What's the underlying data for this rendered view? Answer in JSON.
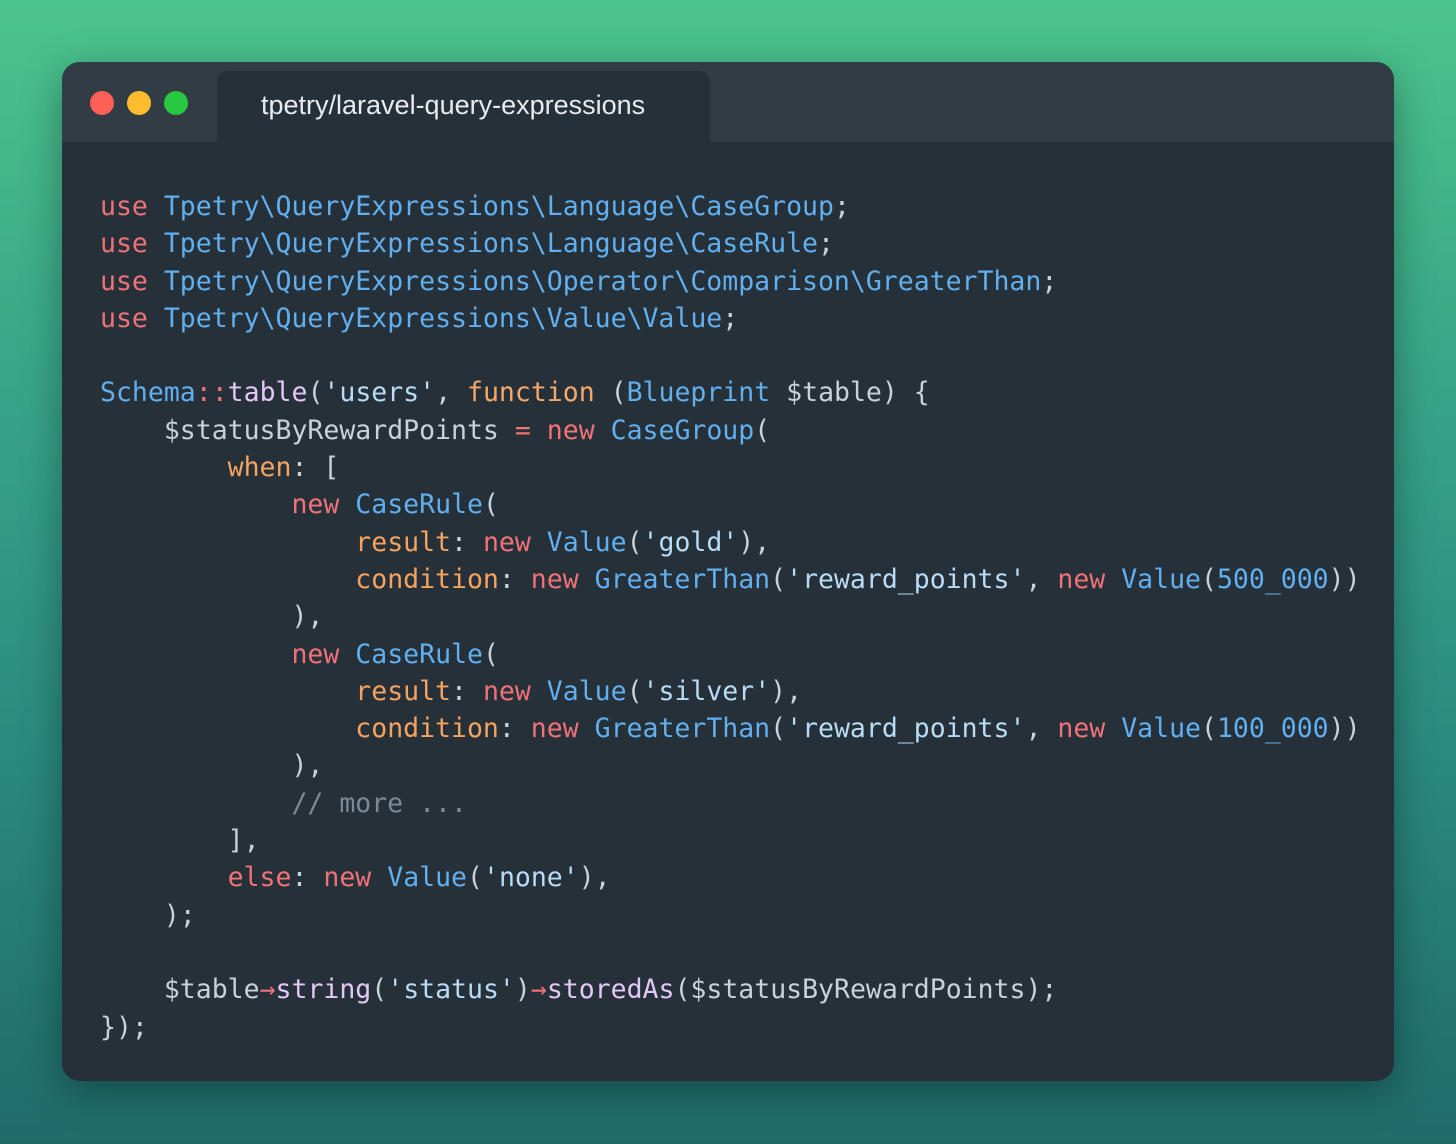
{
  "window": {
    "tab_title": "tpetry/laravel-query-expressions",
    "controls": [
      {
        "name": "close-button",
        "color": "#fe5f57"
      },
      {
        "name": "minimize-button",
        "color": "#febc2e"
      },
      {
        "name": "maximize-button",
        "color": "#28c840"
      }
    ]
  },
  "colors": {
    "keyword": "#f07178",
    "class": "#61afef",
    "string": "#b8dcf6",
    "named_argument": "#f5a35f",
    "method": "#e3c7f6",
    "comment": "#7d8a94",
    "text": "#c9d1d9",
    "background": "#263038"
  },
  "code": {
    "language": "php",
    "lines": [
      [
        [
          "keyword",
          "use"
        ],
        [
          "plain",
          " "
        ],
        [
          "class",
          "Tpetry\\QueryExpressions\\Language\\CaseGroup"
        ],
        [
          "punct",
          ";"
        ]
      ],
      [
        [
          "keyword",
          "use"
        ],
        [
          "plain",
          " "
        ],
        [
          "class",
          "Tpetry\\QueryExpressions\\Language\\CaseRule"
        ],
        [
          "punct",
          ";"
        ]
      ],
      [
        [
          "keyword",
          "use"
        ],
        [
          "plain",
          " "
        ],
        [
          "class",
          "Tpetry\\QueryExpressions\\Operator\\Comparison\\GreaterThan"
        ],
        [
          "punct",
          ";"
        ]
      ],
      [
        [
          "keyword",
          "use"
        ],
        [
          "plain",
          " "
        ],
        [
          "class",
          "Tpetry\\QueryExpressions\\Value\\Value"
        ],
        [
          "punct",
          ";"
        ]
      ],
      [],
      [
        [
          "class",
          "Schema"
        ],
        [
          "operator",
          "::"
        ],
        [
          "method",
          "table"
        ],
        [
          "punct",
          "("
        ],
        [
          "string",
          "'users'"
        ],
        [
          "punct",
          ", "
        ],
        [
          "func",
          "function"
        ],
        [
          "plain",
          " "
        ],
        [
          "punct",
          "("
        ],
        [
          "class",
          "Blueprint"
        ],
        [
          "plain",
          " "
        ],
        [
          "var",
          "$table"
        ],
        [
          "punct",
          ") {"
        ]
      ],
      [
        [
          "plain",
          "    "
        ],
        [
          "var",
          "$statusByRewardPoints"
        ],
        [
          "plain",
          " "
        ],
        [
          "operator",
          "="
        ],
        [
          "plain",
          " "
        ],
        [
          "keyword",
          "new"
        ],
        [
          "plain",
          " "
        ],
        [
          "class",
          "CaseGroup"
        ],
        [
          "punct",
          "("
        ]
      ],
      [
        [
          "plain",
          "        "
        ],
        [
          "named",
          "when"
        ],
        [
          "punct",
          ": ["
        ]
      ],
      [
        [
          "plain",
          "            "
        ],
        [
          "keyword",
          "new"
        ],
        [
          "plain",
          " "
        ],
        [
          "class",
          "CaseRule"
        ],
        [
          "punct",
          "("
        ]
      ],
      [
        [
          "plain",
          "                "
        ],
        [
          "named",
          "result"
        ],
        [
          "punct",
          ": "
        ],
        [
          "keyword",
          "new"
        ],
        [
          "plain",
          " "
        ],
        [
          "class",
          "Value"
        ],
        [
          "punct",
          "("
        ],
        [
          "string",
          "'gold'"
        ],
        [
          "punct",
          "),"
        ]
      ],
      [
        [
          "plain",
          "                "
        ],
        [
          "named",
          "condition"
        ],
        [
          "punct",
          ": "
        ],
        [
          "keyword",
          "new"
        ],
        [
          "plain",
          " "
        ],
        [
          "class",
          "GreaterThan"
        ],
        [
          "punct",
          "("
        ],
        [
          "string",
          "'reward_points'"
        ],
        [
          "punct",
          ", "
        ],
        [
          "keyword",
          "new"
        ],
        [
          "plain",
          " "
        ],
        [
          "class",
          "Value"
        ],
        [
          "punct",
          "("
        ],
        [
          "number",
          "500_000"
        ],
        [
          "punct",
          "))"
        ]
      ],
      [
        [
          "plain",
          "            "
        ],
        [
          "punct",
          "),"
        ]
      ],
      [
        [
          "plain",
          "            "
        ],
        [
          "keyword",
          "new"
        ],
        [
          "plain",
          " "
        ],
        [
          "class",
          "CaseRule"
        ],
        [
          "punct",
          "("
        ]
      ],
      [
        [
          "plain",
          "                "
        ],
        [
          "named",
          "result"
        ],
        [
          "punct",
          ": "
        ],
        [
          "keyword",
          "new"
        ],
        [
          "plain",
          " "
        ],
        [
          "class",
          "Value"
        ],
        [
          "punct",
          "("
        ],
        [
          "string",
          "'silver'"
        ],
        [
          "punct",
          "),"
        ]
      ],
      [
        [
          "plain",
          "                "
        ],
        [
          "named",
          "condition"
        ],
        [
          "punct",
          ": "
        ],
        [
          "keyword",
          "new"
        ],
        [
          "plain",
          " "
        ],
        [
          "class",
          "GreaterThan"
        ],
        [
          "punct",
          "("
        ],
        [
          "string",
          "'reward_points'"
        ],
        [
          "punct",
          ", "
        ],
        [
          "keyword",
          "new"
        ],
        [
          "plain",
          " "
        ],
        [
          "class",
          "Value"
        ],
        [
          "punct",
          "("
        ],
        [
          "number",
          "100_000"
        ],
        [
          "punct",
          "))"
        ]
      ],
      [
        [
          "plain",
          "            "
        ],
        [
          "punct",
          "),"
        ]
      ],
      [
        [
          "plain",
          "            "
        ],
        [
          "comment",
          "// more ..."
        ]
      ],
      [
        [
          "plain",
          "        "
        ],
        [
          "punct",
          "],"
        ]
      ],
      [
        [
          "plain",
          "        "
        ],
        [
          "keyword",
          "else"
        ],
        [
          "punct",
          ": "
        ],
        [
          "keyword",
          "new"
        ],
        [
          "plain",
          " "
        ],
        [
          "class",
          "Value"
        ],
        [
          "punct",
          "("
        ],
        [
          "string",
          "'none'"
        ],
        [
          "punct",
          "),"
        ]
      ],
      [
        [
          "plain",
          "    "
        ],
        [
          "punct",
          ");"
        ]
      ],
      [],
      [
        [
          "plain",
          "    "
        ],
        [
          "var",
          "$table"
        ],
        [
          "operator",
          "→"
        ],
        [
          "method",
          "string"
        ],
        [
          "punct",
          "("
        ],
        [
          "string",
          "'status'"
        ],
        [
          "punct",
          ")"
        ],
        [
          "operator",
          "→"
        ],
        [
          "method",
          "storedAs"
        ],
        [
          "punct",
          "("
        ],
        [
          "var",
          "$statusByRewardPoints"
        ],
        [
          "punct",
          ");"
        ]
      ],
      [
        [
          "punct",
          "});"
        ]
      ]
    ]
  }
}
